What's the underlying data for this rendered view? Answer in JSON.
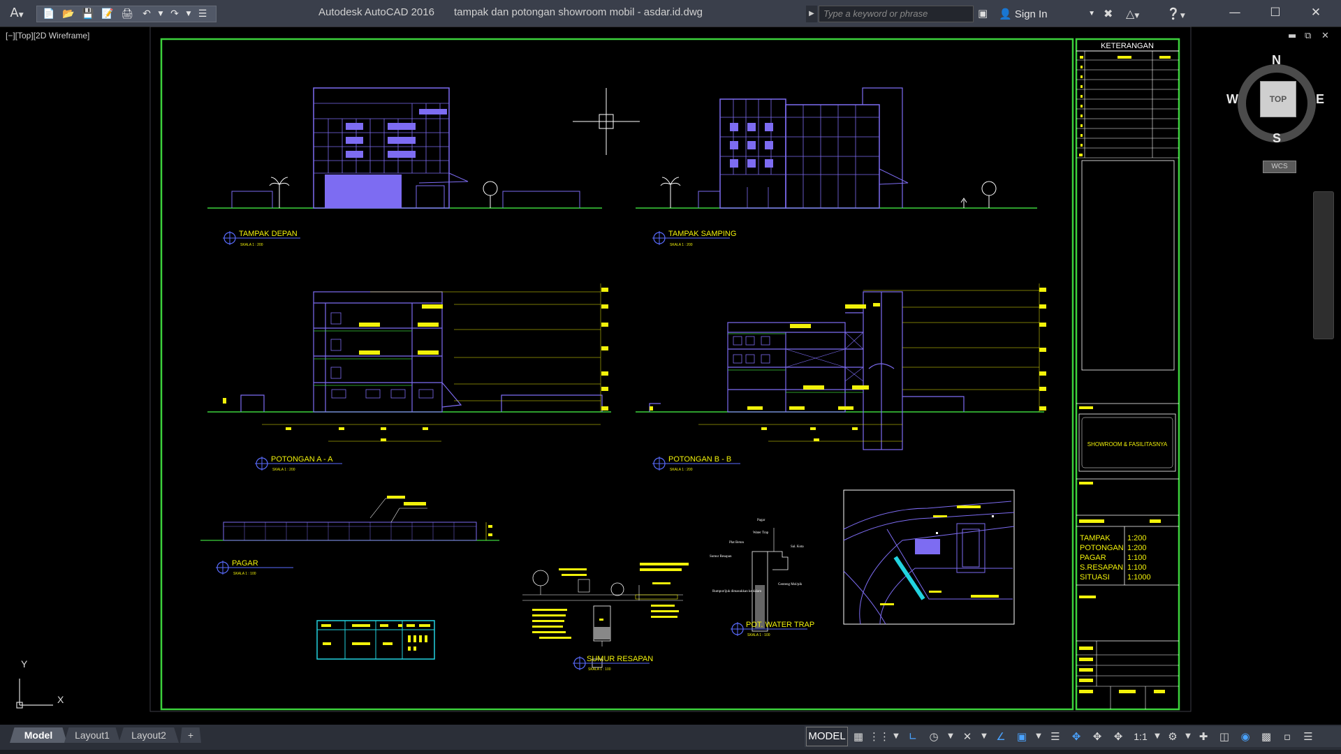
{
  "app": {
    "title": "Autodesk AutoCAD 2016",
    "file_name": "tampak dan potongan showroom mobil - asdar.id.dwg"
  },
  "search": {
    "placeholder": "Type a keyword or phrase"
  },
  "account": {
    "sign_in": "Sign In"
  },
  "viewport": {
    "label": "[−][Top][2D Wireframe]"
  },
  "viewcube": {
    "top": "TOP",
    "north": "N",
    "south": "S",
    "east": "E",
    "west": "W",
    "wcs": "WCS"
  },
  "ucs": {
    "x": "X",
    "y": "Y"
  },
  "layout_tabs": [
    {
      "label": "Model",
      "active": true
    },
    {
      "label": "Layout1",
      "active": false
    },
    {
      "label": "Layout2",
      "active": false
    }
  ],
  "status_bar": {
    "model": "MODEL",
    "annotation_scale": "1:1"
  },
  "drawing": {
    "colors": {
      "background": "#000000",
      "frame": "#3cd23c",
      "building": "#7d6cf2",
      "text_yellow": "#f2f20a",
      "label_blue": "#5a6cff",
      "white": "#ffffff"
    },
    "keterangan": "KETERANGAN",
    "project_title": "SHOWROOM & FASILITASNYA",
    "scale_list": [
      {
        "name": "TAMPAK",
        "scale": "1:200"
      },
      {
        "name": "POTONGAN",
        "scale": "1:200"
      },
      {
        "name": "PAGAR",
        "scale": "1:100"
      },
      {
        "name": "S.RESAPAN",
        "scale": "1:100"
      },
      {
        "name": "SITUASI",
        "scale": "1:1000"
      }
    ],
    "views": [
      {
        "title": "TAMPAK DEPAN",
        "scale": "SKALA    1 : 200"
      },
      {
        "title": "TAMPAK SAMPING",
        "scale": "SKALA    1 : 200"
      },
      {
        "title": "POTONGAN A - A",
        "scale": "SKALA    1 : 200"
      },
      {
        "title": "POTONGAN B - B",
        "scale": "SKALA    1 : 200"
      },
      {
        "title": "PAGAR",
        "scale": "SKALA    1 : 100"
      },
      {
        "title": "SUMUR RESAPAN",
        "scale": "SKALA    1 : 100"
      },
      {
        "title": "POT. WATER TRAP",
        "scale": "SKALA    1 : 100"
      }
    ],
    "water_trap_labels": [
      "Pagar",
      "Water Trap",
      "Plat Beton",
      "Sal. Kota",
      "Sumur Resapan",
      "Genteng Mol/pik",
      "Rumput/ijuk dimasukkan ke dalam"
    ]
  }
}
